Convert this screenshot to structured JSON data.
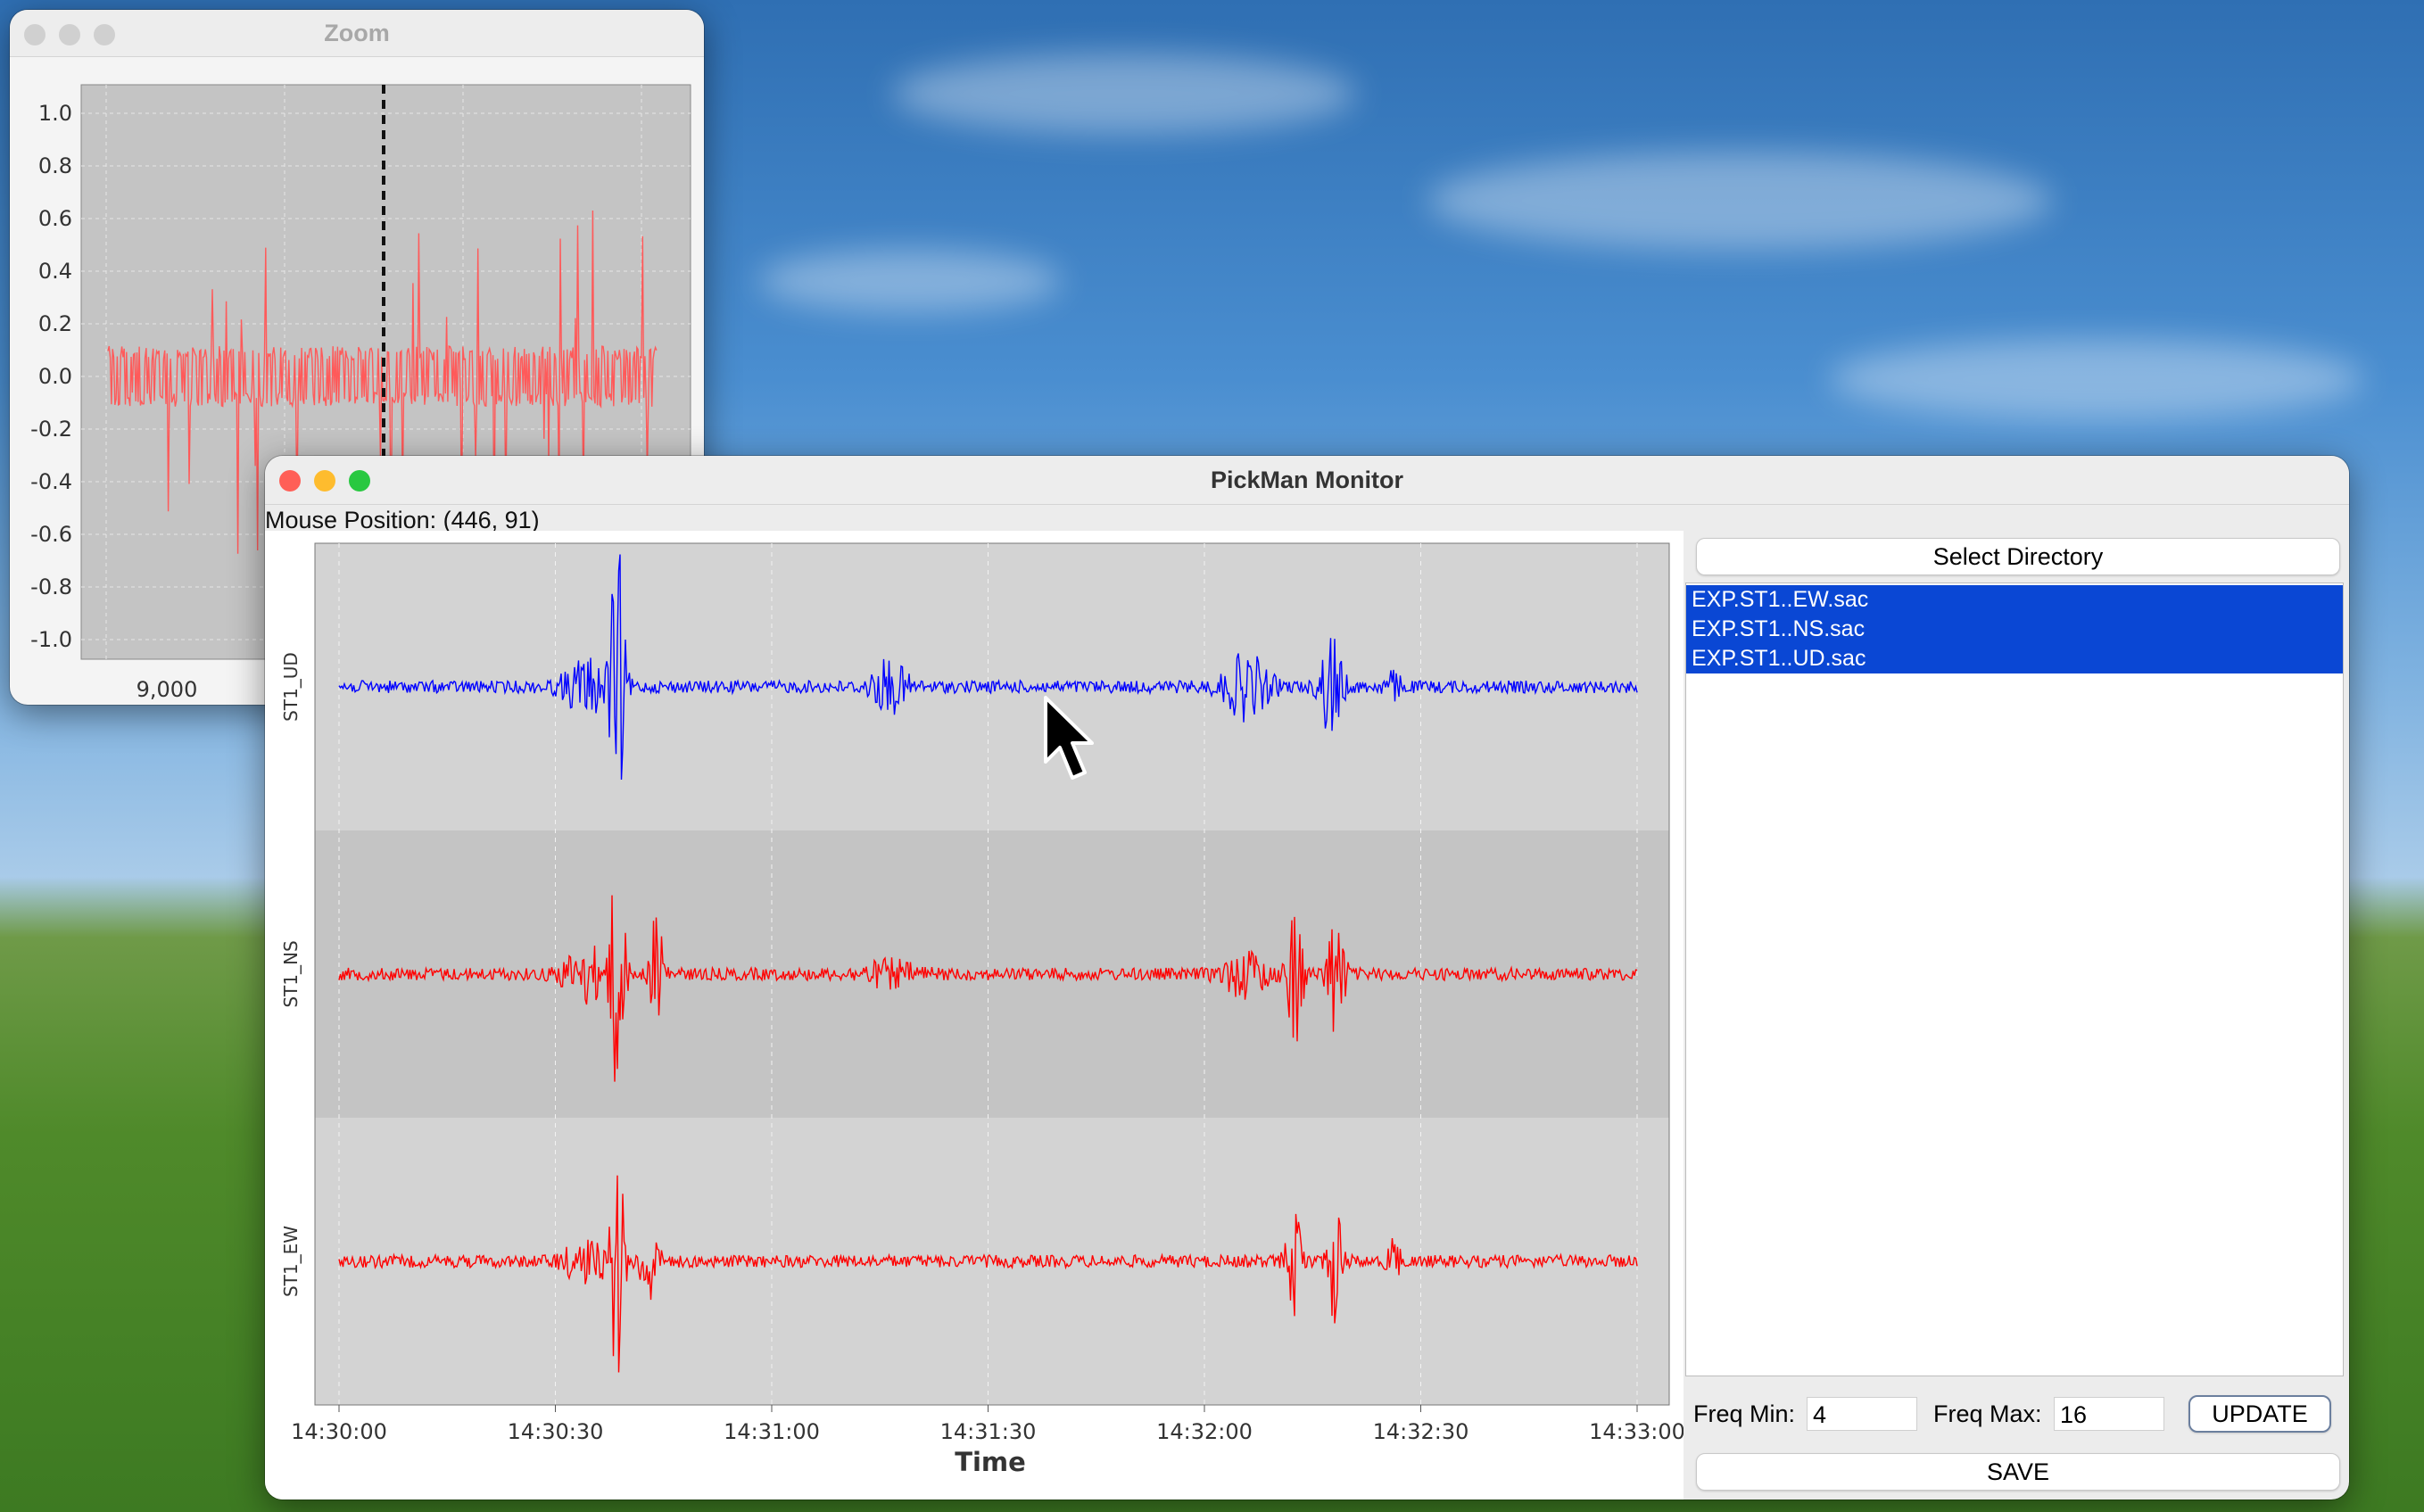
{
  "zoom_window": {
    "title": "Zoom",
    "y_ticks": [
      "1.0",
      "0.8",
      "0.6",
      "0.4",
      "0.2",
      "0.0",
      "-0.2",
      "-0.4",
      "-0.6",
      "-0.8",
      "-1.0"
    ],
    "x_ticks": [
      "9,000"
    ],
    "trace_color": "#ff5a5a",
    "marker_style": "dashed vertical line"
  },
  "main_window": {
    "title": "PickMan Monitor",
    "mouse_position": "Mouse Position: (446, 91)",
    "select_directory_label": "Select Directory",
    "files": [
      "EXP.ST1..EW.sac",
      "EXP.ST1..NS.sac",
      "EXP.ST1..UD.sac"
    ],
    "freq_min_label": "Freq Min:",
    "freq_min_value": "4",
    "freq_max_label": "Freq Max:",
    "freq_max_value": "16",
    "update_label": "UPDATE",
    "save_label": "SAVE"
  },
  "chart_data": {
    "type": "line",
    "xlabel": "Time",
    "x_ticks": [
      "14:30:00",
      "14:30:30",
      "14:31:00",
      "14:31:30",
      "14:32:00",
      "14:32:30",
      "14:33:00"
    ],
    "series": [
      {
        "name": "ST1_UD",
        "color": "#0000ff"
      },
      {
        "name": "ST1_NS",
        "color": "#ff0000"
      },
      {
        "name": "ST1_EW",
        "color": "#ff0000"
      }
    ],
    "grid": true
  }
}
